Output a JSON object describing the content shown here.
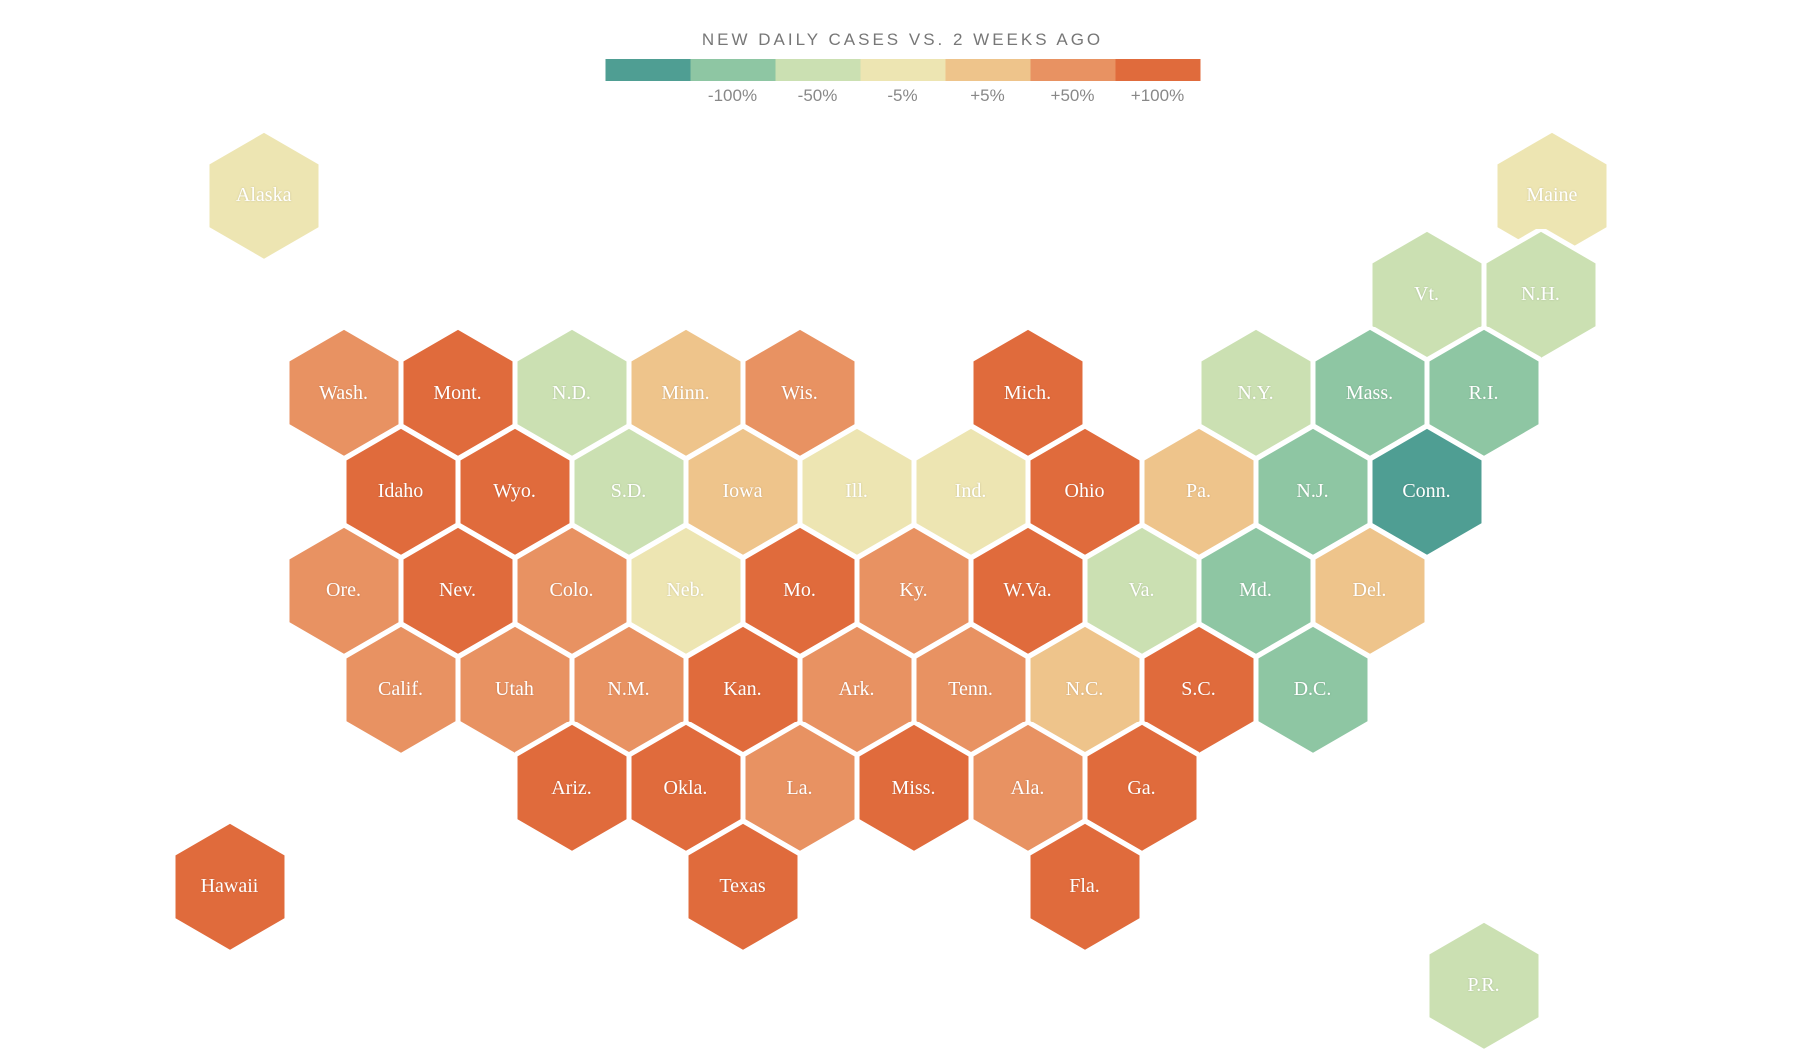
{
  "title": "NEW DAILY CASES VS. 2 WEEKS AGO",
  "chart_data": {
    "type": "heatmap",
    "title": "NEW DAILY CASES VS. 2 WEEKS AGO",
    "legend": {
      "bins": [
        {
          "color": "#4f9e93",
          "label": "-100%"
        },
        {
          "color": "#8ec6a3",
          "label": "-50%"
        },
        {
          "color": "#cbe0b2",
          "label": "-5%"
        },
        {
          "color": "#ede5b2",
          "label": "+5%"
        },
        {
          "color": "#eec48b",
          "label": "+50%"
        },
        {
          "color": "#e89262",
          "label": "+100%"
        },
        {
          "color": "#e06b3c",
          "label": ""
        }
      ]
    },
    "states": [
      {
        "abbr": "Alaska",
        "row": 0,
        "col": 0.3,
        "bucket": 3
      },
      {
        "abbr": "Maine",
        "row": 0,
        "col": 11.6,
        "bucket": 3
      },
      {
        "abbr": "Vt.",
        "row": 1,
        "col": 10.5,
        "bucket": 2
      },
      {
        "abbr": "N.H.",
        "row": 1,
        "col": 11.5,
        "bucket": 2
      },
      {
        "abbr": "Wash.",
        "row": 2,
        "col": 1,
        "bucket": 5
      },
      {
        "abbr": "Mont.",
        "row": 2,
        "col": 2,
        "bucket": 6
      },
      {
        "abbr": "N.D.",
        "row": 2,
        "col": 3,
        "bucket": 2
      },
      {
        "abbr": "Minn.",
        "row": 2,
        "col": 4,
        "bucket": 4
      },
      {
        "abbr": "Wis.",
        "row": 2,
        "col": 5,
        "bucket": 5
      },
      {
        "abbr": "Mich.",
        "row": 2,
        "col": 7,
        "bucket": 6
      },
      {
        "abbr": "N.Y.",
        "row": 2,
        "col": 9,
        "bucket": 2
      },
      {
        "abbr": "Mass.",
        "row": 2,
        "col": 10,
        "bucket": 1
      },
      {
        "abbr": "R.I.",
        "row": 2,
        "col": 11,
        "bucket": 1
      },
      {
        "abbr": "Idaho",
        "row": 3,
        "col": 1.5,
        "bucket": 6
      },
      {
        "abbr": "Wyo.",
        "row": 3,
        "col": 2.5,
        "bucket": 6
      },
      {
        "abbr": "S.D.",
        "row": 3,
        "col": 3.5,
        "bucket": 2
      },
      {
        "abbr": "Iowa",
        "row": 3,
        "col": 4.5,
        "bucket": 4
      },
      {
        "abbr": "Ill.",
        "row": 3,
        "col": 5.5,
        "bucket": 3
      },
      {
        "abbr": "Ind.",
        "row": 3,
        "col": 6.5,
        "bucket": 3
      },
      {
        "abbr": "Ohio",
        "row": 3,
        "col": 7.5,
        "bucket": 6
      },
      {
        "abbr": "Pa.",
        "row": 3,
        "col": 8.5,
        "bucket": 4
      },
      {
        "abbr": "N.J.",
        "row": 3,
        "col": 9.5,
        "bucket": 1
      },
      {
        "abbr": "Conn.",
        "row": 3,
        "col": 10.5,
        "bucket": 0
      },
      {
        "abbr": "Ore.",
        "row": 4,
        "col": 1,
        "bucket": 5
      },
      {
        "abbr": "Nev.",
        "row": 4,
        "col": 2,
        "bucket": 6
      },
      {
        "abbr": "Colo.",
        "row": 4,
        "col": 3,
        "bucket": 5
      },
      {
        "abbr": "Neb.",
        "row": 4,
        "col": 4,
        "bucket": 3
      },
      {
        "abbr": "Mo.",
        "row": 4,
        "col": 5,
        "bucket": 6
      },
      {
        "abbr": "Ky.",
        "row": 4,
        "col": 6,
        "bucket": 5
      },
      {
        "abbr": "W.Va.",
        "row": 4,
        "col": 7,
        "bucket": 6
      },
      {
        "abbr": "Va.",
        "row": 4,
        "col": 8,
        "bucket": 2
      },
      {
        "abbr": "Md.",
        "row": 4,
        "col": 9,
        "bucket": 1
      },
      {
        "abbr": "Del.",
        "row": 4,
        "col": 10,
        "bucket": 4
      },
      {
        "abbr": "Calif.",
        "row": 5,
        "col": 1.5,
        "bucket": 5
      },
      {
        "abbr": "Utah",
        "row": 5,
        "col": 2.5,
        "bucket": 5
      },
      {
        "abbr": "N.M.",
        "row": 5,
        "col": 3.5,
        "bucket": 5
      },
      {
        "abbr": "Kan.",
        "row": 5,
        "col": 4.5,
        "bucket": 6
      },
      {
        "abbr": "Ark.",
        "row": 5,
        "col": 5.5,
        "bucket": 5
      },
      {
        "abbr": "Tenn.",
        "row": 5,
        "col": 6.5,
        "bucket": 5
      },
      {
        "abbr": "N.C.",
        "row": 5,
        "col": 7.5,
        "bucket": 4
      },
      {
        "abbr": "S.C.",
        "row": 5,
        "col": 8.5,
        "bucket": 6
      },
      {
        "abbr": "D.C.",
        "row": 5,
        "col": 9.5,
        "bucket": 1
      },
      {
        "abbr": "Ariz.",
        "row": 6,
        "col": 3,
        "bucket": 6
      },
      {
        "abbr": "Okla.",
        "row": 6,
        "col": 4,
        "bucket": 6
      },
      {
        "abbr": "La.",
        "row": 6,
        "col": 5,
        "bucket": 5
      },
      {
        "abbr": "Miss.",
        "row": 6,
        "col": 6,
        "bucket": 6
      },
      {
        "abbr": "Ala.",
        "row": 6,
        "col": 7,
        "bucket": 5
      },
      {
        "abbr": "Ga.",
        "row": 6,
        "col": 8,
        "bucket": 6
      },
      {
        "abbr": "Hawaii",
        "row": 7,
        "col": 0,
        "bucket": 6
      },
      {
        "abbr": "Texas",
        "row": 7,
        "col": 4.5,
        "bucket": 6
      },
      {
        "abbr": "Fla.",
        "row": 7,
        "col": 7.5,
        "bucket": 6
      },
      {
        "abbr": "P.R.",
        "row": 8,
        "col": 11,
        "bucket": 2
      }
    ]
  }
}
